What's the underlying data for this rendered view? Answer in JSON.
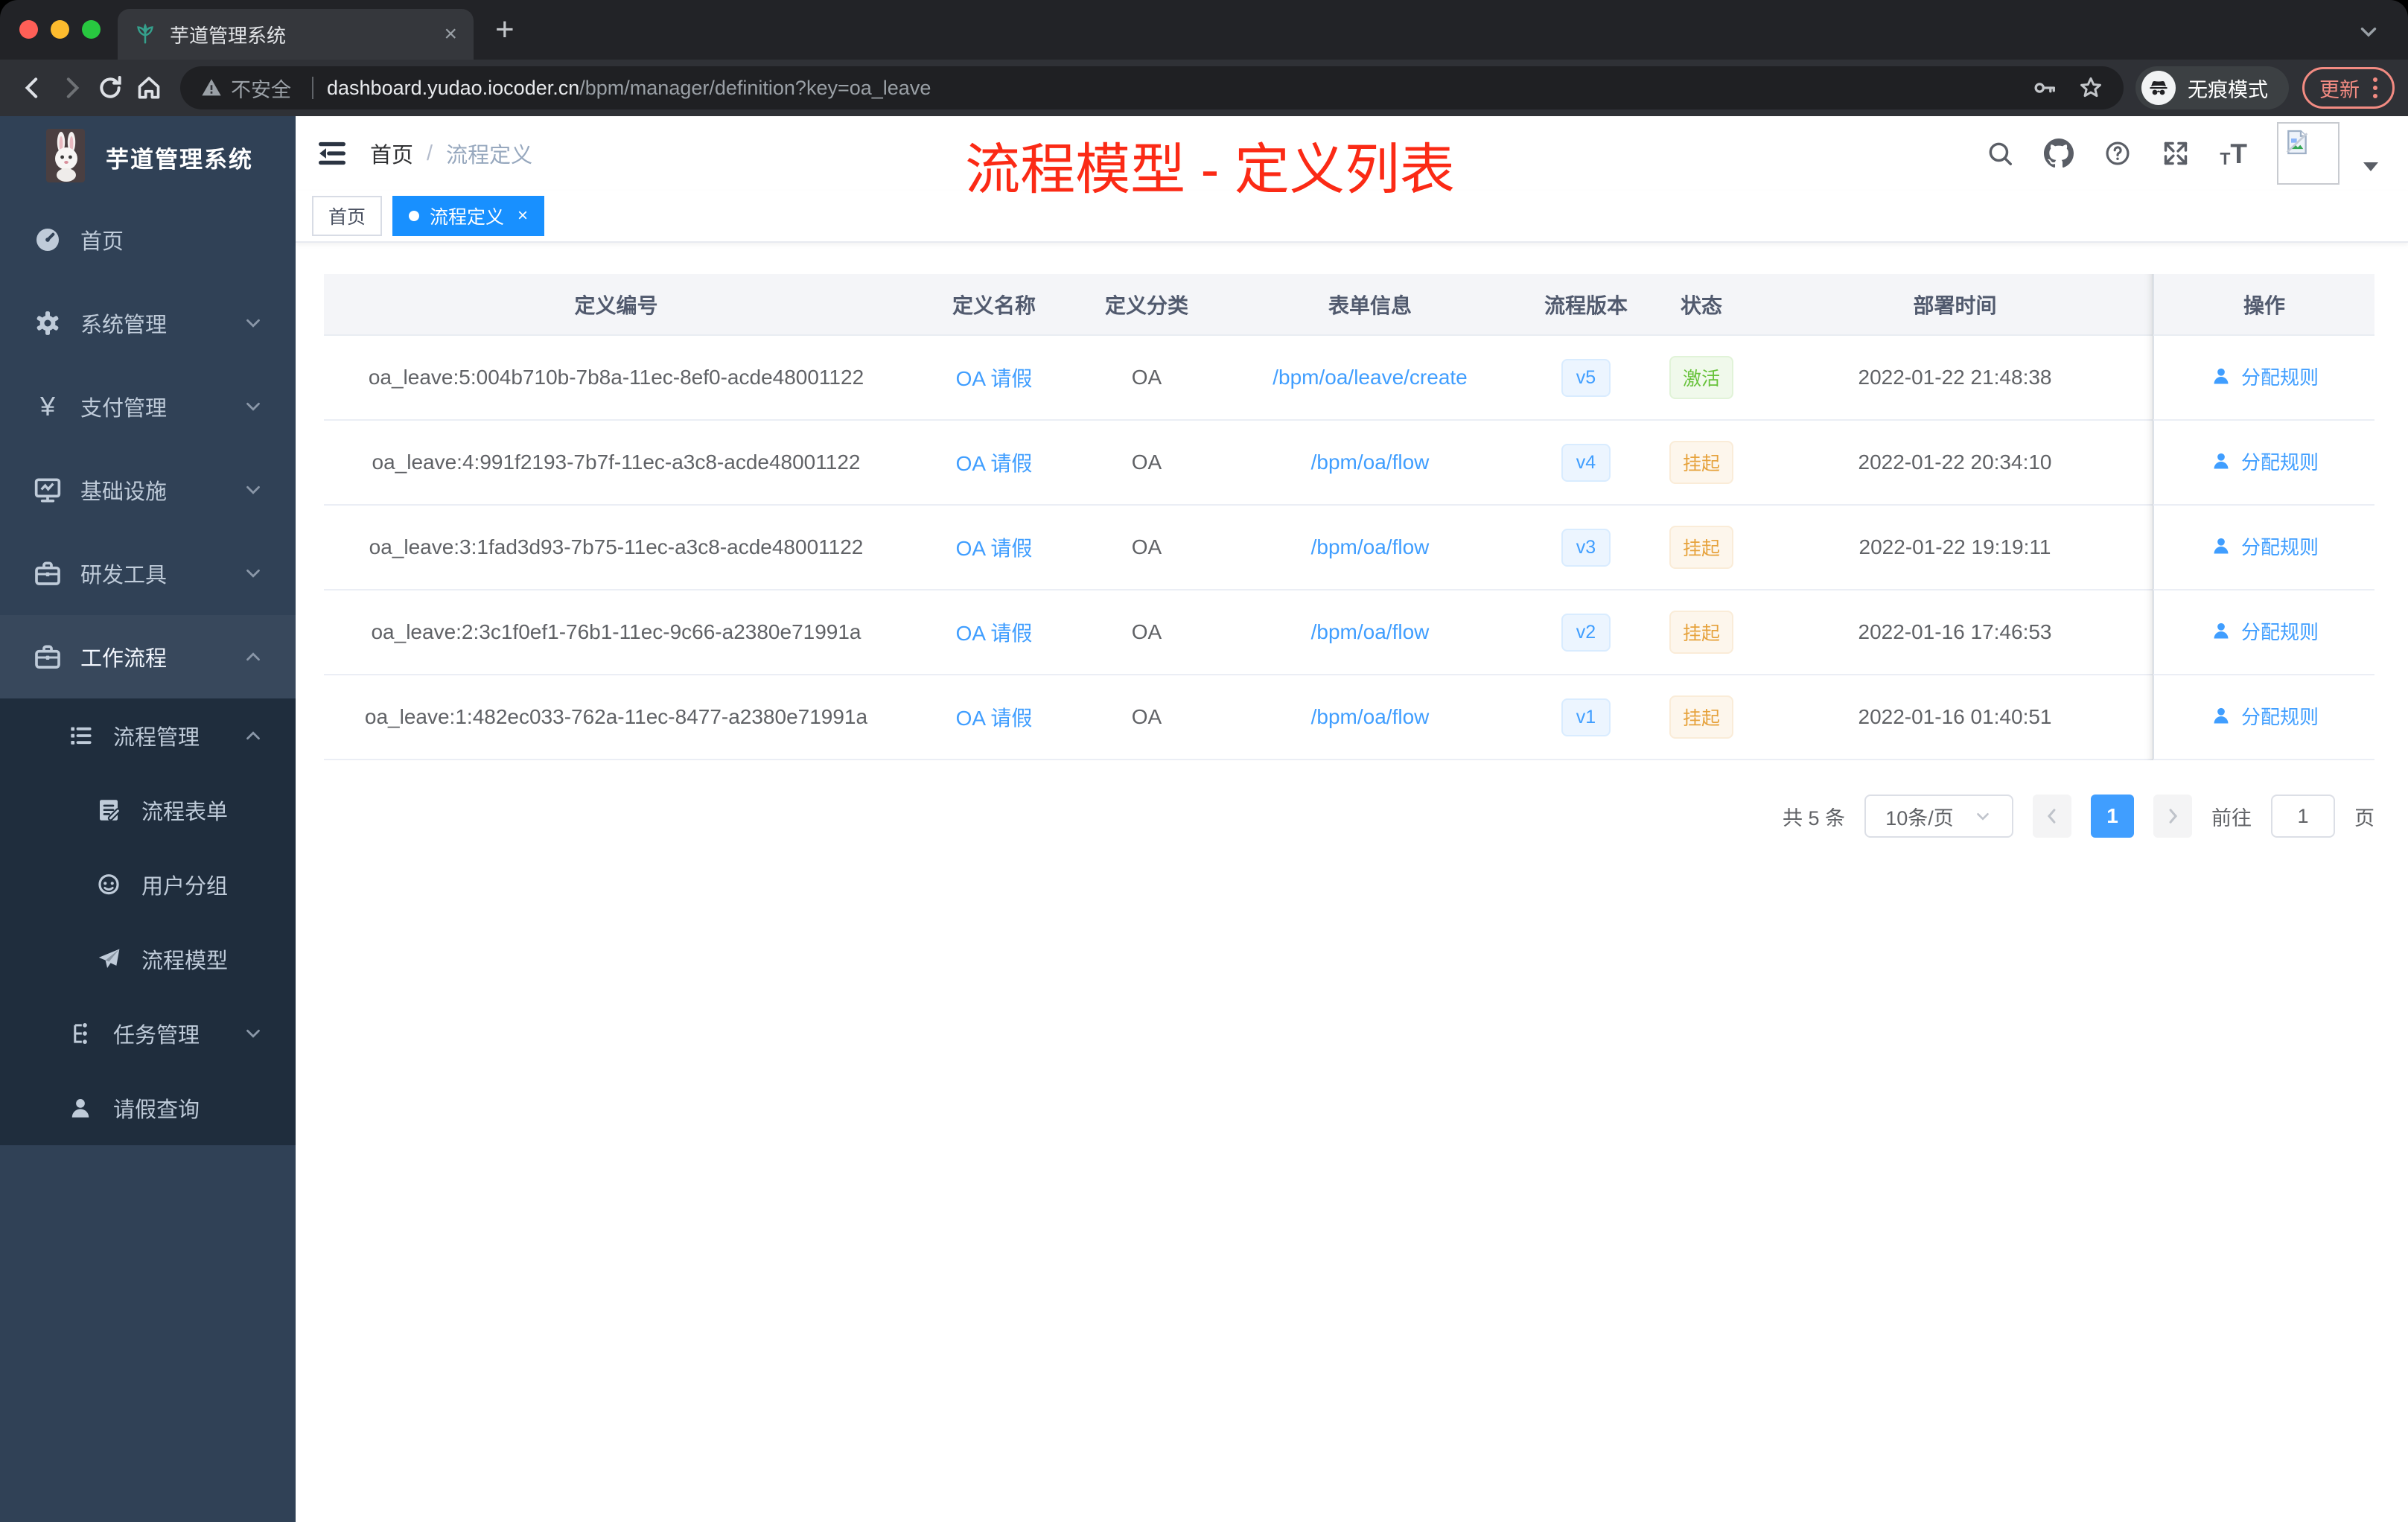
{
  "colors": {
    "accent": "#409eff",
    "active_tag": "#1890ff",
    "annotation": "#fb2a15",
    "status_active": "#67c23a",
    "status_suspended": "#e6a23c",
    "sidebar_bg": "#304156",
    "sidebar_submenu_bg": "#1f2d3d"
  },
  "browser": {
    "tab_title": "芋道管理系统",
    "new_tab_label": "+",
    "security_label": "不安全",
    "url_host": "dashboard.yudao.iocoder.cn",
    "url_path": "/bpm/manager/definition?key=oa_leave",
    "incognito_label": "无痕模式",
    "update_label": "更新"
  },
  "sidebar": {
    "app_title": "芋道管理系统",
    "items": [
      {
        "label": "首页",
        "icon": "dashboard",
        "level": 0,
        "chevron": null,
        "dark": false,
        "active": false
      },
      {
        "label": "系统管理",
        "icon": "gear",
        "level": 0,
        "chevron": "down",
        "dark": false,
        "active": false
      },
      {
        "label": "支付管理",
        "icon": "yen",
        "level": 0,
        "chevron": "down",
        "dark": false,
        "active": false
      },
      {
        "label": "基础设施",
        "icon": "monitor",
        "level": 0,
        "chevron": "down",
        "dark": false,
        "active": false
      },
      {
        "label": "研发工具",
        "icon": "toolbox",
        "level": 0,
        "chevron": "down",
        "dark": false,
        "active": false
      },
      {
        "label": "工作流程",
        "icon": "briefcase",
        "level": 0,
        "chevron": "up",
        "dark": false,
        "active": true
      },
      {
        "label": "流程管理",
        "icon": "process-list",
        "level": 1,
        "chevron": "up",
        "dark": true,
        "active": false
      },
      {
        "label": "流程表单",
        "icon": "form-doc",
        "level": 2,
        "chevron": null,
        "dark": true,
        "active": false
      },
      {
        "label": "用户分组",
        "icon": "user-group",
        "level": 2,
        "chevron": null,
        "dark": true,
        "active": false
      },
      {
        "label": "流程模型",
        "icon": "paper-plane",
        "level": 2,
        "chevron": null,
        "dark": true,
        "active": false
      },
      {
        "label": "任务管理",
        "icon": "task-tree",
        "level": 1,
        "chevron": "down",
        "dark": true,
        "active": false
      },
      {
        "label": "请假查询",
        "icon": "person",
        "level": 1,
        "chevron": null,
        "dark": true,
        "active": false
      }
    ]
  },
  "header": {
    "breadcrumb_home": "首页",
    "breadcrumb_separator": "/",
    "breadcrumb_current": "流程定义"
  },
  "annotation": {
    "title": "流程模型 - 定义列表"
  },
  "tags": [
    {
      "label": "首页",
      "active": false
    },
    {
      "label": "流程定义",
      "active": true,
      "close": "×"
    }
  ],
  "table": {
    "columns": [
      "定义编号",
      "定义名称",
      "定义分类",
      "表单信息",
      "流程版本",
      "状态",
      "部署时间",
      "操作"
    ],
    "action_label": "分配规则",
    "rows": [
      {
        "id": "oa_leave:5:004b710b-7b8a-11ec-8ef0-acde48001122",
        "name": "OA 请假",
        "category": "OA",
        "form": "/bpm/oa/leave/create",
        "version": "v5",
        "status": "激活",
        "status_type": "success",
        "deploy_time": "2022-01-22 21:48:38",
        "action": "分配规则"
      },
      {
        "id": "oa_leave:4:991f2193-7b7f-11ec-a3c8-acde48001122",
        "name": "OA 请假",
        "category": "OA",
        "form": "/bpm/oa/flow",
        "version": "v4",
        "status": "挂起",
        "status_type": "warning",
        "deploy_time": "2022-01-22 20:34:10",
        "action": "分配规则"
      },
      {
        "id": "oa_leave:3:1fad3d93-7b75-11ec-a3c8-acde48001122",
        "name": "OA 请假",
        "category": "OA",
        "form": "/bpm/oa/flow",
        "version": "v3",
        "status": "挂起",
        "status_type": "warning",
        "deploy_time": "2022-01-22 19:19:11",
        "action": "分配规则"
      },
      {
        "id": "oa_leave:2:3c1f0ef1-76b1-11ec-9c66-a2380e71991a",
        "name": "OA 请假",
        "category": "OA",
        "form": "/bpm/oa/flow",
        "version": "v2",
        "status": "挂起",
        "status_type": "warning",
        "deploy_time": "2022-01-16 17:46:53",
        "action": "分配规则"
      },
      {
        "id": "oa_leave:1:482ec033-762a-11ec-8477-a2380e71991a",
        "name": "OA 请假",
        "category": "OA",
        "form": "/bpm/oa/flow",
        "version": "v1",
        "status": "挂起",
        "status_type": "warning",
        "deploy_time": "2022-01-16 01:40:51",
        "action": "分配规则"
      }
    ]
  },
  "pagination": {
    "total_label": "共 5 条",
    "page_size_label": "10条/页",
    "current_page": "1",
    "goto_label": "前往",
    "goto_value": "1",
    "page_unit": "页"
  }
}
